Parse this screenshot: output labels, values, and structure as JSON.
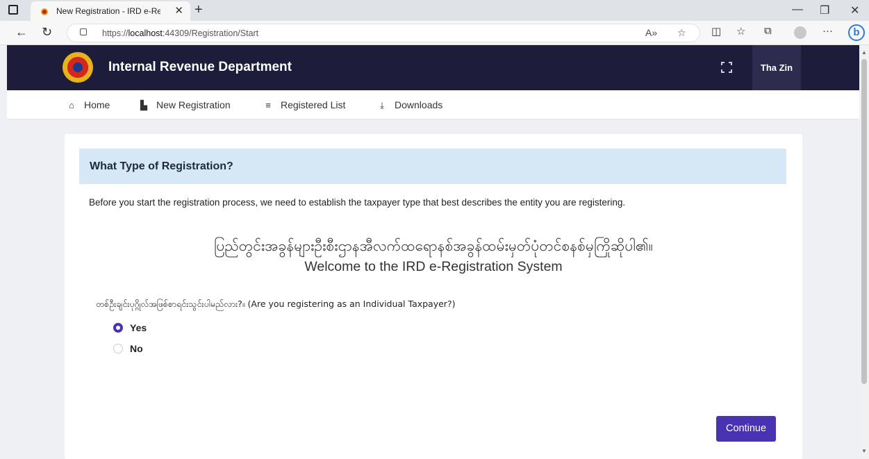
{
  "browser": {
    "tab_title": "New Registration - IRD e-Registr",
    "url_prefix": "https://",
    "url_host": "localhost",
    "url_rest": ":44309/Registration/Start"
  },
  "header": {
    "title": "Internal Revenue Department",
    "user_name": "Tha Zin"
  },
  "nav": {
    "items": [
      {
        "label": "Home",
        "icon": "home-icon"
      },
      {
        "label": "New Registration",
        "icon": "document-icon"
      },
      {
        "label": "Registered List",
        "icon": "list-icon"
      },
      {
        "label": "Downloads",
        "icon": "download-icon"
      }
    ]
  },
  "card": {
    "title": "What Type of Registration?",
    "intro": "Before you start the registration process, we need to establish the taxpayer type that best describes the entity you are registering.",
    "myanmar_title": "ပြည်တွင်းအခွန်များဦးစီးဌာနအီလက်ထရောနစ်အခွန်ထမ်းမှတ်ပုံတင်စနစ်မှကြိုဆိုပါ၏။",
    "welcome": "Welcome to the IRD e-Registration System",
    "question": "တစ်ဦးချင်းပုဂ္ဂိုလ်အဖြစ်စာရင်းသွင်းပါမည်လား?။ (Are you registering as an Individual Taxpayer?)",
    "options": [
      {
        "label": "Yes",
        "selected": true
      },
      {
        "label": "No",
        "selected": false
      }
    ],
    "continue_label": "Continue"
  },
  "colors": {
    "header_bg": "#1d1c3a",
    "accent": "#4a33b3",
    "card_head_bg": "#d6e7f5"
  }
}
